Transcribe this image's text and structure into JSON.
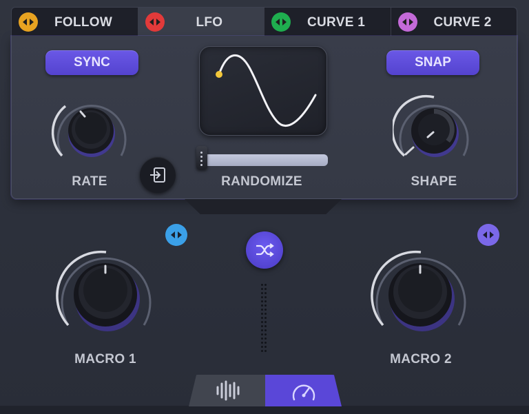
{
  "tabs": [
    {
      "label": "FOLLOW",
      "color": "#e8a321",
      "active": false
    },
    {
      "label": "LFO",
      "color": "#e23a3a",
      "active": true
    },
    {
      "label": "CURVE 1",
      "color": "#1fae4f",
      "active": false
    },
    {
      "label": "CURVE 2",
      "color": "#c46ad8",
      "active": false
    }
  ],
  "lfo_panel": {
    "sync_label": "SYNC",
    "snap_label": "SNAP",
    "rate_label": "RATE",
    "shape_label": "SHAPE",
    "randomize_label": "RANDOMIZE",
    "rate_value": 0.3,
    "shape_value": 0.6,
    "randomize_value": 0.0
  },
  "macros": {
    "macro1_label": "MACRO 1",
    "macro2_label": "MACRO 2",
    "macro1_value": 0.5,
    "macro2_value": 0.5,
    "macro1_color": "#3ba0e8",
    "macro2_color": "#7b68e8"
  },
  "bottom_tabs": [
    {
      "icon": "waveform-icon",
      "active": false
    },
    {
      "icon": "gauge-icon",
      "active": true
    }
  ],
  "colors": {
    "accent": "#5c4ad8",
    "panel": "#373b47",
    "background": "#2c303b"
  }
}
